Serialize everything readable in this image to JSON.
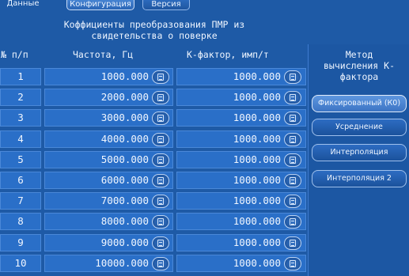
{
  "tabs": [
    {
      "label": "Данные"
    },
    {
      "label": "Конфигурация"
    },
    {
      "label": "Версия"
    }
  ],
  "title": {
    "line1": "Коффициенты преобразования ПМР из",
    "line2": "свидетельства о поверке"
  },
  "table": {
    "headers": {
      "num": "№ п/п",
      "freq": "Частота, Гц",
      "kf": "К-фактор, имп/т"
    },
    "rows": [
      {
        "num": "1",
        "freq": "1000.000",
        "kf": "1000.000"
      },
      {
        "num": "2",
        "freq": "2000.000",
        "kf": "1000.000"
      },
      {
        "num": "3",
        "freq": "3000.000",
        "kf": "1000.000"
      },
      {
        "num": "4",
        "freq": "4000.000",
        "kf": "1000.000"
      },
      {
        "num": "5",
        "freq": "5000.000",
        "kf": "1000.000"
      },
      {
        "num": "6",
        "freq": "6000.000",
        "kf": "1000.000"
      },
      {
        "num": "7",
        "freq": "7000.000",
        "kf": "1000.000"
      },
      {
        "num": "8",
        "freq": "8000.000",
        "kf": "1000.000"
      },
      {
        "num": "9",
        "freq": "9000.000",
        "kf": "1000.000"
      },
      {
        "num": "10",
        "freq": "10000.000",
        "kf": "1000.000"
      }
    ]
  },
  "method_panel": {
    "title_line1": "Метод",
    "title_line2": "вычисления К-",
    "title_line3": "фактора",
    "buttons": [
      {
        "label": "Фиксированный (К0)",
        "selected": true
      },
      {
        "label": "Усреднение",
        "selected": false
      },
      {
        "label": "Интерполяция",
        "selected": false
      },
      {
        "label": "Интерполяция 2",
        "selected": false
      }
    ]
  },
  "colors": {
    "background": "#1e5aa6",
    "cell": "#2a6fc8",
    "text": "#e8f1ff"
  }
}
